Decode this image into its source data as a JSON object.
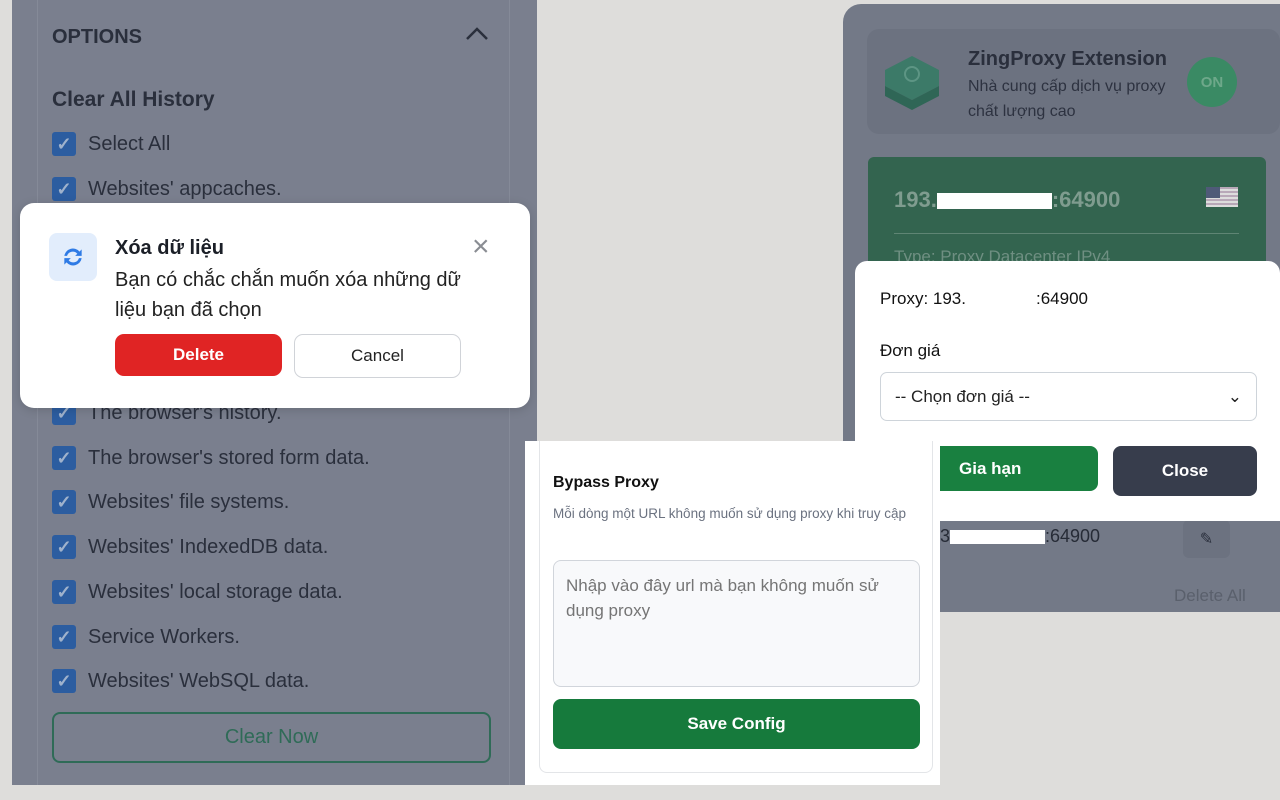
{
  "cleaner": {
    "options_title": "OPTIONS",
    "clear_history_title": "Clear All History",
    "items": [
      {
        "label": "Select All",
        "checked": true
      },
      {
        "label": "Websites' appcaches.",
        "checked": true
      },
      {
        "label": "The browser's history.",
        "checked": true
      },
      {
        "label": "The browser's stored form data.",
        "checked": true
      },
      {
        "label": "Websites' file systems.",
        "checked": true
      },
      {
        "label": "Websites' IndexedDB data.",
        "checked": true
      },
      {
        "label": "Websites' local storage data.",
        "checked": true
      },
      {
        "label": "Service Workers.",
        "checked": true
      },
      {
        "label": "Websites' WebSQL data.",
        "checked": true
      }
    ],
    "clear_now": "Clear Now"
  },
  "confirm_dialog": {
    "title": "Xóa dữ liệu",
    "message": "Bạn có chắc chắn muốn xóa những dữ liệu bạn đã chọn",
    "delete": "Delete",
    "cancel": "Cancel",
    "icon": "refresh-icon"
  },
  "extension": {
    "name": "ZingProxy Extension",
    "subtitle": "Nhà cung cấp dịch vụ proxy chất lượng cao",
    "toggle": "ON",
    "proxy_card": {
      "ip_prefix": "193.",
      "ip_suffix": ":64900",
      "type": "Type: Proxy Datacenter IPv4",
      "country": "US"
    },
    "list_item": {
      "ip_prefix": "3",
      "ip_suffix": ":64900"
    },
    "delete_all": "Delete All"
  },
  "renew_modal": {
    "proxy_label": "Proxy: 193.",
    "proxy_suffix": ":64900",
    "price_label": "Đơn giá",
    "price_select": "-- Chọn đơn giá --",
    "renew": "Gia hạn",
    "close": "Close"
  },
  "bypass": {
    "title": "Bypass Proxy",
    "description": "Mỗi dòng một URL không muốn sử dụng proxy khi truy cập",
    "placeholder": "Nhập vào đây url mà bạn không muốn sử dụng proxy",
    "save": "Save Config"
  },
  "colors": {
    "accent_green": "#198040",
    "danger": "#e02424",
    "dark": "#373d4c",
    "checkbox": "#2c5da0"
  }
}
